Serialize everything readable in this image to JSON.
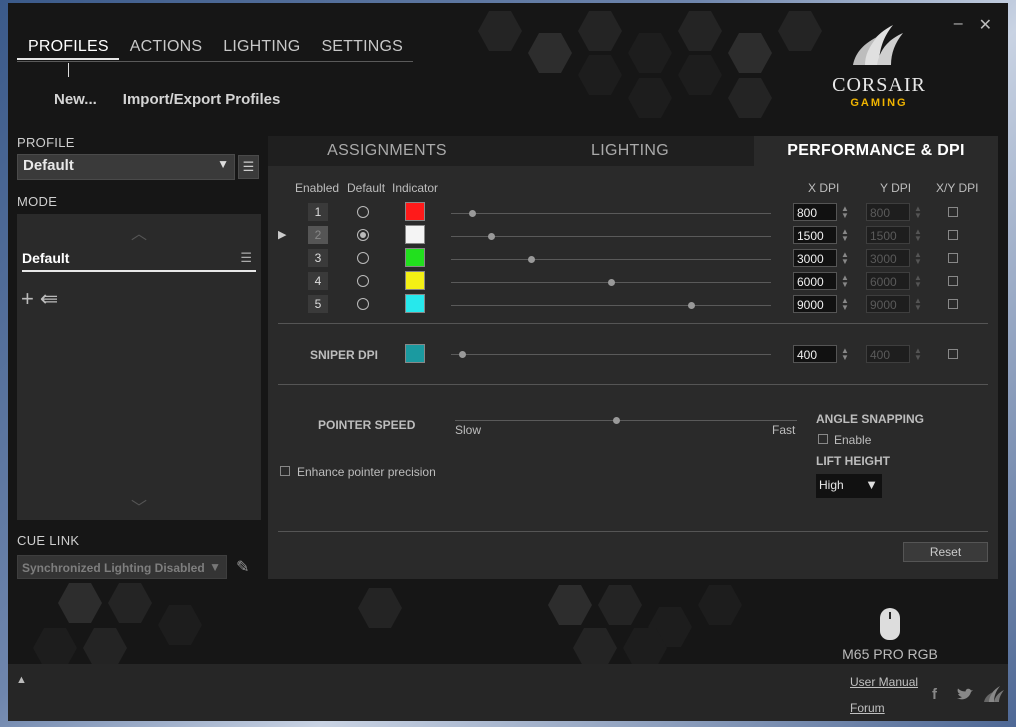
{
  "window": {
    "minimize_glyph": "–",
    "close_glyph": "✕"
  },
  "topnav": {
    "items": [
      "PROFILES",
      "ACTIONS",
      "LIGHTING",
      "SETTINGS"
    ],
    "active": "PROFILES"
  },
  "subnav": {
    "new_label": "New...",
    "import_export_label": "Import/Export Profiles"
  },
  "brand": {
    "name": "CORSAIR",
    "tagline": "GAMING",
    "tagline_color": "#f0b400"
  },
  "sidebar": {
    "profile_label": "PROFILE",
    "profile_value": "Default",
    "mode_label": "MODE",
    "mode_item": "Default",
    "cue_link_label": "CUE LINK",
    "cue_link_value": "Synchronized Lighting Disabled"
  },
  "tabs": {
    "items": [
      "ASSIGNMENTS",
      "LIGHTING",
      "PERFORMANCE & DPI"
    ],
    "active": "PERFORMANCE & DPI"
  },
  "dpi_table": {
    "headers": {
      "enabled": "Enabled",
      "default": "Default",
      "indicator": "Indicator",
      "x_dpi": "X DPI",
      "y_dpi": "Y DPI",
      "xy_dpi": "X/Y DPI"
    },
    "slider_max_dpi": 12000,
    "rows": [
      {
        "num": "1",
        "default": false,
        "active": false,
        "color": "#ff1a1a",
        "x": "800",
        "y": "800",
        "x_val": 800
      },
      {
        "num": "2",
        "default": true,
        "active": true,
        "color": "#f4f4f4",
        "x": "1500",
        "y": "1500",
        "x_val": 1500
      },
      {
        "num": "3",
        "default": false,
        "active": false,
        "color": "#22e01e",
        "x": "3000",
        "y": "3000",
        "x_val": 3000
      },
      {
        "num": "4",
        "default": false,
        "active": false,
        "color": "#f4f015",
        "x": "6000",
        "y": "6000",
        "x_val": 6000
      },
      {
        "num": "5",
        "default": false,
        "active": false,
        "color": "#27e8ec",
        "x": "9000",
        "y": "9000",
        "x_val": 9000
      }
    ],
    "sniper": {
      "label": "SNIPER DPI",
      "color": "#1b9aa0",
      "x": "400",
      "y": "400",
      "x_val": 400
    }
  },
  "pointer": {
    "label": "POINTER SPEED",
    "slow": "Slow",
    "fast": "Fast",
    "value_fraction": 0.47,
    "enhance_label": "Enhance pointer precision"
  },
  "angle_snapping": {
    "label": "ANGLE SNAPPING",
    "enable_label": "Enable"
  },
  "lift_height": {
    "label": "LIFT HEIGHT",
    "value": "High"
  },
  "reset_label": "Reset",
  "device": {
    "name": "M65 PRO RGB"
  },
  "footer": {
    "user_manual": "User Manual",
    "forum": "Forum"
  }
}
